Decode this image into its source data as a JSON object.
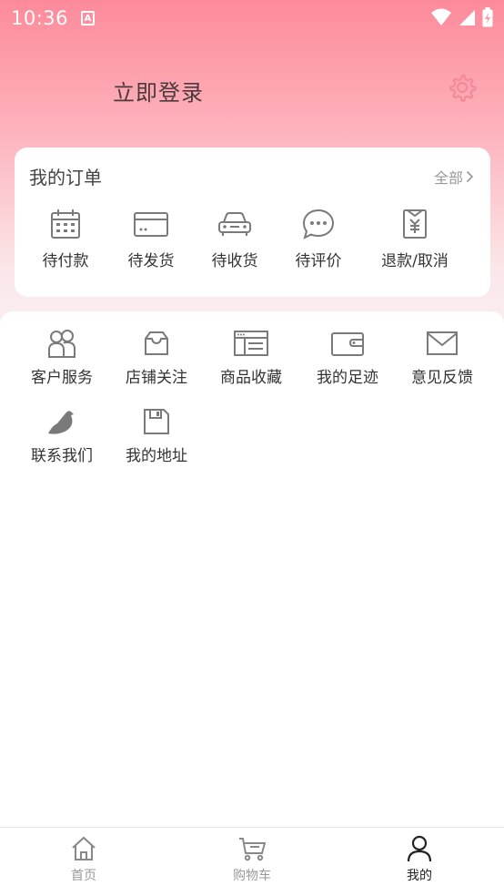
{
  "status_bar": {
    "time": "10:36",
    "notif_letter": "A"
  },
  "header": {
    "login_label": "立即登录"
  },
  "orders": {
    "title": "我的订单",
    "all_label": "全部",
    "items": [
      {
        "label": "待付款",
        "icon": "calendar-icon"
      },
      {
        "label": "待发货",
        "icon": "card-icon"
      },
      {
        "label": "待收货",
        "icon": "car-icon"
      },
      {
        "label": "待评价",
        "icon": "chat-bubble-icon"
      },
      {
        "label": "退款/取消",
        "icon": "refund-receipt-icon"
      }
    ]
  },
  "services": [
    {
      "label": "客户服务",
      "icon": "customer-service-icon"
    },
    {
      "label": "店铺关注",
      "icon": "inbox-tray-icon"
    },
    {
      "label": "商品收藏",
      "icon": "browser-window-icon"
    },
    {
      "label": "我的足迹",
      "icon": "wallet-icon"
    },
    {
      "label": "意见反馈",
      "icon": "mail-icon"
    },
    {
      "label": "联系我们",
      "icon": "bird-icon"
    },
    {
      "label": "我的地址",
      "icon": "floppy-disk-icon"
    }
  ],
  "tabbar": {
    "tabs": [
      {
        "label": "首页",
        "icon": "home-icon"
      },
      {
        "label": "购物车",
        "icon": "cart-icon"
      },
      {
        "label": "我的",
        "icon": "user-icon"
      }
    ],
    "active": "我的"
  },
  "colors": {
    "accent": "#fd8a9a",
    "settings_icon": "#f48a98",
    "icon_gray": "#7a7a7a"
  }
}
